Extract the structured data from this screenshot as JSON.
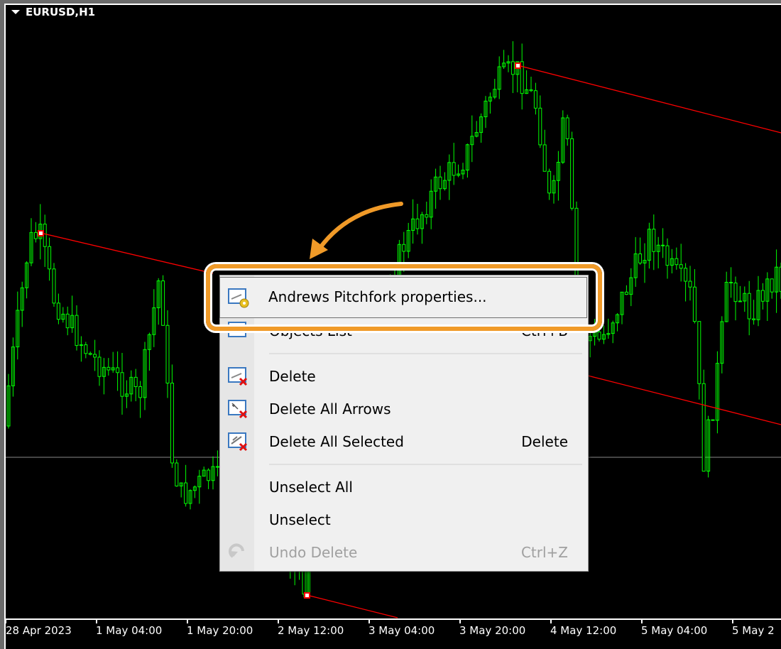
{
  "chart": {
    "symbol_title": "EURUSD,H1",
    "colors": {
      "background": "#000000",
      "candle": "#00ff00",
      "pitchfork": "#ff0000",
      "highlight": "#f09a28"
    },
    "time_labels": [
      "28 Apr 2023",
      "1 May 04:00",
      "1 May 20:00",
      "2 May 12:00",
      "3 May 04:00",
      "3 May 20:00",
      "4 May 12:00",
      "5 May 04:00",
      "5 May 2"
    ]
  },
  "context_menu": {
    "items": [
      {
        "label": "Andrews Pitchfork properties...",
        "shortcut": "",
        "icon": "properties-gear-icon",
        "highlighted": true
      },
      {
        "label": "Objects List",
        "shortcut": "Ctrl+B",
        "icon": "objects-list-icon"
      },
      {
        "label": "Delete",
        "shortcut": "",
        "icon": "delete-object-icon"
      },
      {
        "label": "Delete All Arrows",
        "shortcut": "",
        "icon": "delete-arrows-icon"
      },
      {
        "label": "Delete All Selected",
        "shortcut": "Delete",
        "icon": "delete-selected-icon"
      },
      {
        "label": "Unselect All",
        "shortcut": ""
      },
      {
        "label": "Unselect",
        "shortcut": ""
      },
      {
        "label": "Undo Delete",
        "shortcut": "Ctrl+Z",
        "icon": "undo-icon",
        "disabled": true
      }
    ]
  }
}
